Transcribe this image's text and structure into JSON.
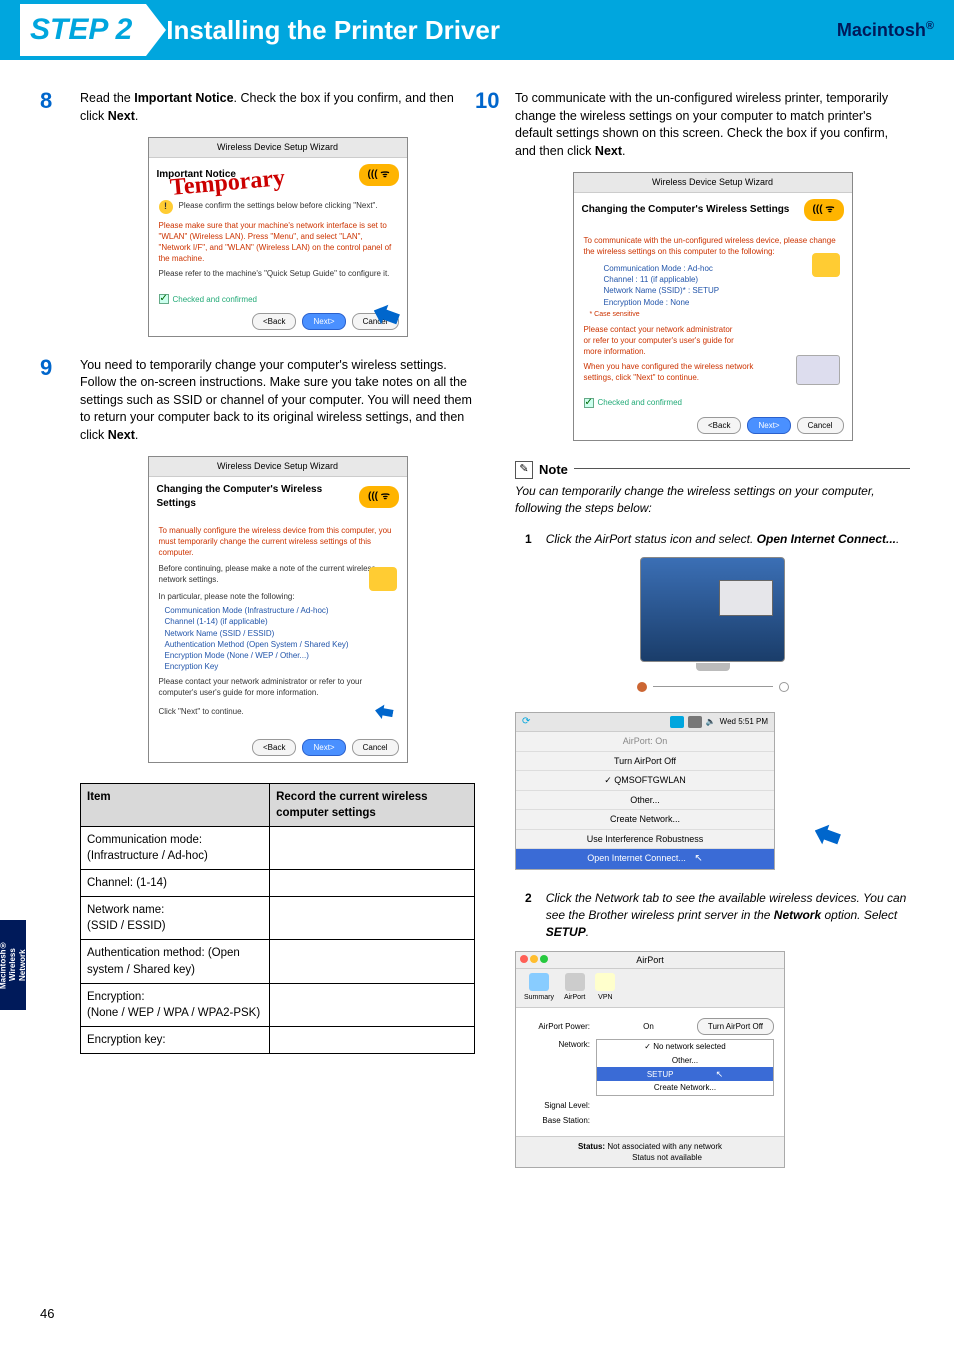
{
  "header": {
    "step": "STEP 2",
    "title": "Installing the Printer Driver",
    "platform": "Macintosh",
    "reg": "®"
  },
  "page_number": "46",
  "side_tab": {
    "line1": "Macintosh®",
    "line2": "Wireless",
    "line3": "Network"
  },
  "left": {
    "s8": {
      "num": "8",
      "text_pre": "Read the ",
      "bold1": "Important Notice",
      "text_mid": ". Check the box if you confirm, and then click ",
      "bold2": "Next",
      "text_post": "."
    },
    "fig8": {
      "titlebar": "Wireless Device Setup Wizard",
      "heading": "Important Notice",
      "body_l1": "Please confirm the settings below before clicking \"Next\".",
      "body_l2": "Please make sure that your machine's network interface is set to \"WLAN\" (Wireless LAN). Press \"Menu\", and select \"LAN\", \"Network I/F\", and \"WLAN\" (Wireless LAN) on the control panel of the machine.",
      "body_l3": "Please refer to the machine's \"Quick Setup Guide\" to configure it.",
      "checked": "Checked and confirmed",
      "stamp": "Temporary",
      "btn_back": "<Back",
      "btn_next": "Next>",
      "btn_cancel": "Cancel"
    },
    "s9": {
      "num": "9",
      "text": "You need to temporarily change your computer's wireless settings. Follow the on-screen instructions. Make sure you take notes on all the settings such as SSID or channel of your computer. You will need them to return your computer back to its original wireless settings, and then click ",
      "bold": "Next",
      "text_post": "."
    },
    "fig9": {
      "titlebar": "Wireless Device Setup Wizard",
      "heading": "Changing the Computer's Wireless Settings",
      "body_l1": "To manually configure the wireless device from this computer, you must temporarily change the current wireless settings of this computer.",
      "body_l2": "Before continuing, please make a note of the current wireless network settings.",
      "body_l3": "In particular, please note the following:",
      "li1": "Communication Mode (Infrastructure / Ad-hoc)",
      "li2": "Channel (1-14) (if applicable)",
      "li3": "Network Name (SSID / ESSID)",
      "li4": "Authentication Method (Open System / Shared Key)",
      "li5": "Encryption Mode (None / WEP / Other...)",
      "li6": "Encryption Key",
      "body_l4": "Please contact your network administrator or refer to your computer's user's guide for more information.",
      "body_l5": "Click \"Next\" to continue.",
      "btn_back": "<Back",
      "btn_next": "Next>",
      "btn_cancel": "Cancel"
    },
    "table": {
      "th1": "Item",
      "th2": "Record the current wireless computer settings",
      "r1": "Communication mode: (Infrastructure / Ad-hoc)",
      "r2": "Channel: (1-14)",
      "r3": "Network name:\n(SSID / ESSID)",
      "r4": "Authentication method: (Open system / Shared key)",
      "r5": "Encryption:\n(None / WEP / WPA / WPA2-PSK)",
      "r6": "Encryption key:"
    }
  },
  "right": {
    "s10": {
      "num": "10",
      "text": "To communicate with the un-configured wireless printer, temporarily change the wireless settings on your computer to match printer's default settings shown on this screen. Check the box if you confirm, and then click ",
      "bold": "Next",
      "text_post": "."
    },
    "fig10": {
      "titlebar": "Wireless Device Setup Wizard",
      "heading": "Changing the Computer's Wireless Settings",
      "body_l1": "To communicate with the un-configured wireless device, please change the wireless settings on this computer to the following:",
      "kv1l": "Communication Mode :",
      "kv1v": "Ad-hoc",
      "kv2l": "Channel :",
      "kv2v": "11  (if applicable)",
      "kv3l": "Network Name (SSID)* :",
      "kv3v": "SETUP",
      "kv4l": "Encryption Mode :",
      "kv4v": "None",
      "note_cs": "* Case sensitive",
      "body_l2": "Please contact your network administrator or refer to your computer's user's guide for more information.",
      "body_l3": "When you have configured the wireless network settings, click \"Next\" to continue.",
      "checked": "Checked and confirmed",
      "btn_back": "<Back",
      "btn_next": "Next>",
      "btn_cancel": "Cancel"
    },
    "note": {
      "label": "Note",
      "body": "You can temporarily change the wireless settings on your computer, following the steps below:"
    },
    "sub1": {
      "num": "1",
      "text_pre": "Click the AirPort status icon and select. ",
      "bold": "Open Internet Connect...",
      "text_post": "."
    },
    "menubar": {
      "clock": "Wed 5:51 PM",
      "r1": "AirPort: On",
      "r2": "Turn AirPort Off",
      "r3": "QMSOFTGWLAN",
      "r4": "Other...",
      "r5": "Create Network...",
      "r6": "Use Interference Robustness",
      "r7": "Open Internet Connect..."
    },
    "sub2": {
      "num": "2",
      "text_pre": "Click the Network tab to see the available wireless devices. You can see the Brother wireless print server in the ",
      "bold1": "Network",
      "text_mid": " option. Select ",
      "bold2": "SETUP",
      "text_post": "."
    },
    "airport": {
      "title": "AirPort",
      "tab1": "Summary",
      "tab2": "AirPort",
      "tab3": "VPN",
      "power_lbl": "AirPort Power:",
      "power_val": "On",
      "power_btn": "Turn AirPort Off",
      "net_lbl": "Network:",
      "net_val": "No network selected",
      "dd0": "✓ No network selected",
      "dd1": "Other...",
      "dd2": "SETUP",
      "dd3": "Create Network...",
      "sig_lbl": "Signal Level:",
      "base_lbl": "Base Station:",
      "status_lbl": "Status:",
      "status_v1": "Not associated with any network",
      "status_v2": "Status not available"
    }
  }
}
